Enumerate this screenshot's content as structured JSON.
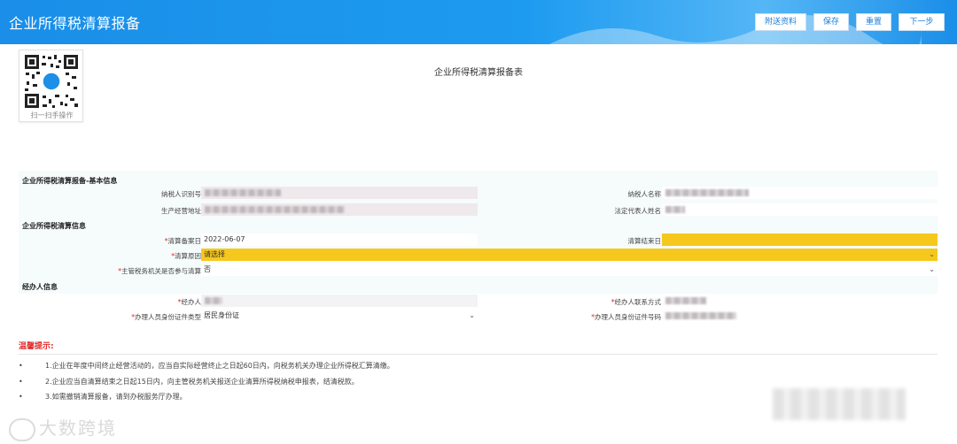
{
  "header": {
    "title": "企业所得税清算报备",
    "buttons": {
      "attach": "附送资料",
      "save": "保存",
      "reset": "重置",
      "next": "下一步"
    }
  },
  "qr": {
    "label": "扫一扫手操作"
  },
  "form_title": "企业所得税清算报备表",
  "basic": {
    "title": "企业所得税清算报备-基本信息",
    "taxpayer_id_label": "纳税人识别号",
    "taxpayer_name_label": "纳税人名称",
    "address_label": "生产经营地址",
    "legal_rep_label": "法定代表人姓名"
  },
  "liquidation": {
    "title": "企业所得税清算信息",
    "start_date_label": "清算备案日",
    "start_date_value": "2022-06-07",
    "end_date_label": "清算结束日",
    "end_date_value": "",
    "reason_label": "清算原因",
    "reason_value": "请选择",
    "authority_label": "主管税务机关是否参与清算",
    "authority_value": "否"
  },
  "agent": {
    "title": "经办人信息",
    "agent_label": "经办人",
    "contact_label": "经办人联系方式",
    "id_type_label": "办理人员身份证件类型",
    "id_type_value": "居民身份证",
    "id_number_label": "办理人员身份证件号码"
  },
  "tips": {
    "title": "温馨提示:",
    "items": [
      "1.企业在年度中间终止经营活动的，应当自实际经营终止之日起60日内，向税务机关办理企业所得税汇算清缴。",
      "2.企业应当自清算结束之日起15日内，向主管税务机关报送企业清算所得税纳税申报表，结清税款。",
      "3.如需撤销清算报备，请到办税服务厅办理。"
    ]
  },
  "watermark": "大数跨境",
  "colors": {
    "header": "#1d9bf0",
    "highlight": "#f6c81e",
    "required": "#e02020"
  }
}
